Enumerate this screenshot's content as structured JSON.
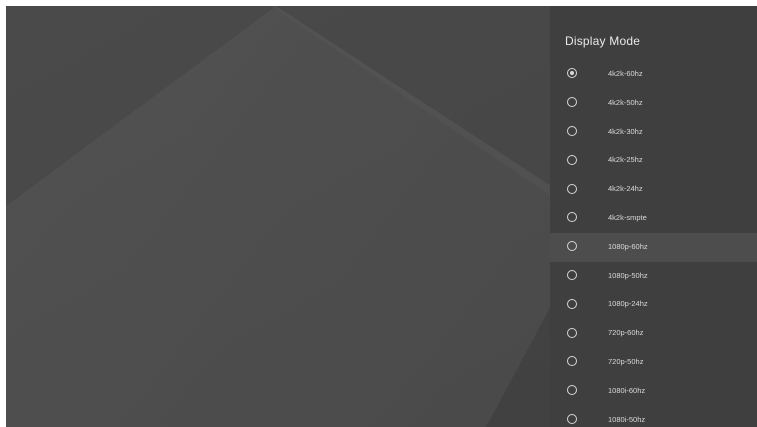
{
  "panel": {
    "title": "Display Mode",
    "selected_index": 0,
    "focused_index": 6,
    "options": [
      {
        "label": "4k2k-60hz"
      },
      {
        "label": "4k2k-50hz"
      },
      {
        "label": "4k2k-30hz"
      },
      {
        "label": "4k2k-25hz"
      },
      {
        "label": "4k2k-24hz"
      },
      {
        "label": "4k2k-smpte"
      },
      {
        "label": "1080p-60hz"
      },
      {
        "label": "1080p-50hz"
      },
      {
        "label": "1080p-24hz"
      },
      {
        "label": "720p-60hz"
      },
      {
        "label": "720p-50hz"
      },
      {
        "label": "1080i-60hz"
      },
      {
        "label": "1080i-50hz"
      }
    ]
  },
  "colors": {
    "background": "#484848",
    "panel": "#3f3f3f",
    "focused_row": "#4d4d4d",
    "text": "#d8d8d8"
  }
}
